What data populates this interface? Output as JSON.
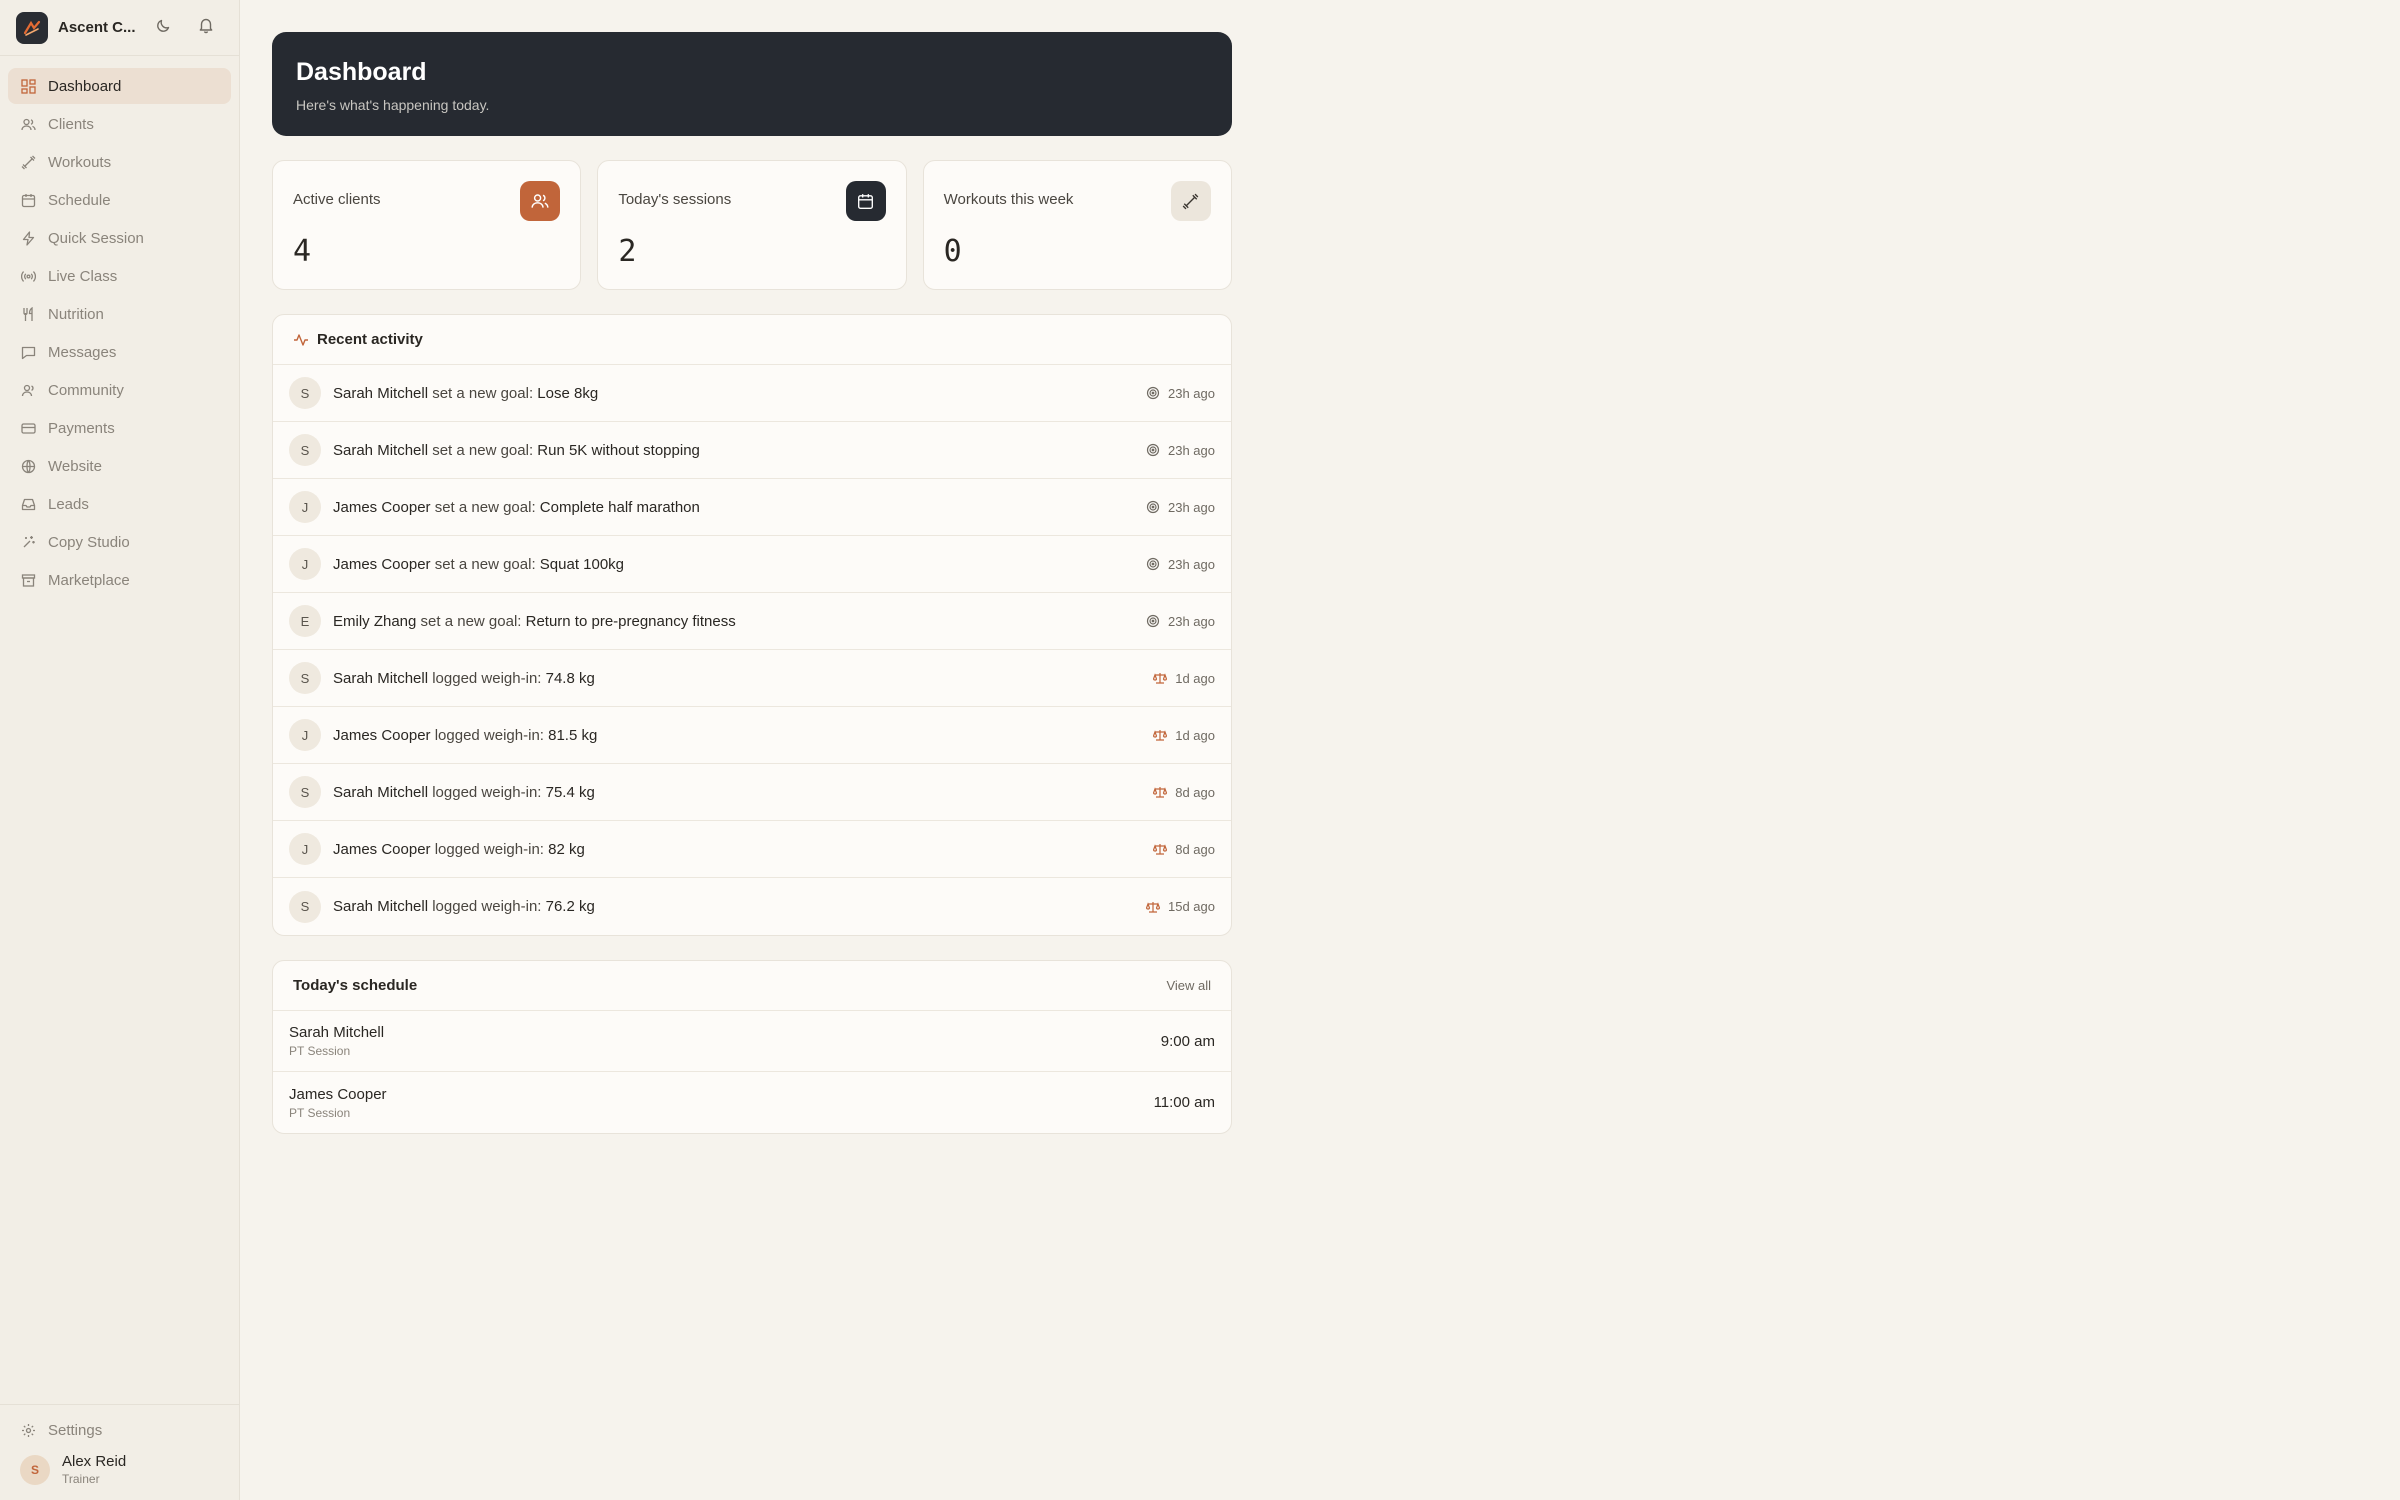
{
  "app": {
    "name": "Ascent C..."
  },
  "sidebar": {
    "items": [
      {
        "label": "Dashboard",
        "icon": "grid-icon"
      },
      {
        "label": "Clients",
        "icon": "users-icon"
      },
      {
        "label": "Workouts",
        "icon": "dumbbell-icon"
      },
      {
        "label": "Schedule",
        "icon": "calendar-icon"
      },
      {
        "label": "Quick Session",
        "icon": "bolt-icon"
      },
      {
        "label": "Live Class",
        "icon": "broadcast-icon"
      },
      {
        "label": "Nutrition",
        "icon": "utensils-icon"
      },
      {
        "label": "Messages",
        "icon": "message-icon"
      },
      {
        "label": "Community",
        "icon": "community-icon"
      },
      {
        "label": "Payments",
        "icon": "card-icon"
      },
      {
        "label": "Website",
        "icon": "globe-icon"
      },
      {
        "label": "Leads",
        "icon": "inbox-icon"
      },
      {
        "label": "Copy Studio",
        "icon": "sparkle-icon"
      },
      {
        "label": "Marketplace",
        "icon": "store-icon"
      }
    ],
    "settings_label": "Settings",
    "user": {
      "initial": "S",
      "name": "Alex Reid",
      "role": "Trainer"
    }
  },
  "hero": {
    "title": "Dashboard",
    "subtitle": "Here's what's happening today."
  },
  "stats": [
    {
      "label": "Active clients",
      "value": "4",
      "icon": "users-icon",
      "color": "#c1653a"
    },
    {
      "label": "Today's sessions",
      "value": "2",
      "icon": "calendar-icon",
      "color": "#262a31"
    },
    {
      "label": "Workouts this week",
      "value": "0",
      "icon": "dumbbell-icon",
      "color": "#ece6dc"
    }
  ],
  "activity": {
    "title": "Recent activity",
    "rows": [
      {
        "initial": "S",
        "name": "Sarah Mitchell",
        "action": " set a new goal: ",
        "value": "Lose 8kg",
        "icon": "target-icon",
        "time": "23h ago"
      },
      {
        "initial": "S",
        "name": "Sarah Mitchell",
        "action": " set a new goal: ",
        "value": "Run 5K without stopping",
        "icon": "target-icon",
        "time": "23h ago"
      },
      {
        "initial": "J",
        "name": "James Cooper",
        "action": " set a new goal: ",
        "value": "Complete half marathon",
        "icon": "target-icon",
        "time": "23h ago"
      },
      {
        "initial": "J",
        "name": "James Cooper",
        "action": " set a new goal: ",
        "value": "Squat 100kg",
        "icon": "target-icon",
        "time": "23h ago"
      },
      {
        "initial": "E",
        "name": "Emily Zhang",
        "action": " set a new goal: ",
        "value": "Return to pre-pregnancy fitness",
        "icon": "target-icon",
        "time": "23h ago"
      },
      {
        "initial": "S",
        "name": "Sarah Mitchell",
        "action": " logged weigh-in: ",
        "value": "74.8 kg",
        "icon": "scale-icon",
        "time": "1d ago"
      },
      {
        "initial": "J",
        "name": "James Cooper",
        "action": " logged weigh-in: ",
        "value": "81.5 kg",
        "icon": "scale-icon",
        "time": "1d ago"
      },
      {
        "initial": "S",
        "name": "Sarah Mitchell",
        "action": " logged weigh-in: ",
        "value": "75.4 kg",
        "icon": "scale-icon",
        "time": "8d ago"
      },
      {
        "initial": "J",
        "name": "James Cooper",
        "action": " logged weigh-in: ",
        "value": "82 kg",
        "icon": "scale-icon",
        "time": "8d ago"
      },
      {
        "initial": "S",
        "name": "Sarah Mitchell",
        "action": " logged weigh-in: ",
        "value": "76.2 kg",
        "icon": "scale-icon",
        "time": "15d ago"
      }
    ]
  },
  "schedule": {
    "title": "Today's schedule",
    "view_all": "View all",
    "rows": [
      {
        "name": "Sarah Mitchell",
        "type": "PT Session",
        "time": "9:00 am"
      },
      {
        "name": "James Cooper",
        "type": "PT Session",
        "time": "11:00 am"
      }
    ]
  },
  "colors": {
    "accent": "#c1653a",
    "dark": "#262a31",
    "background": "#f6f3ed"
  }
}
